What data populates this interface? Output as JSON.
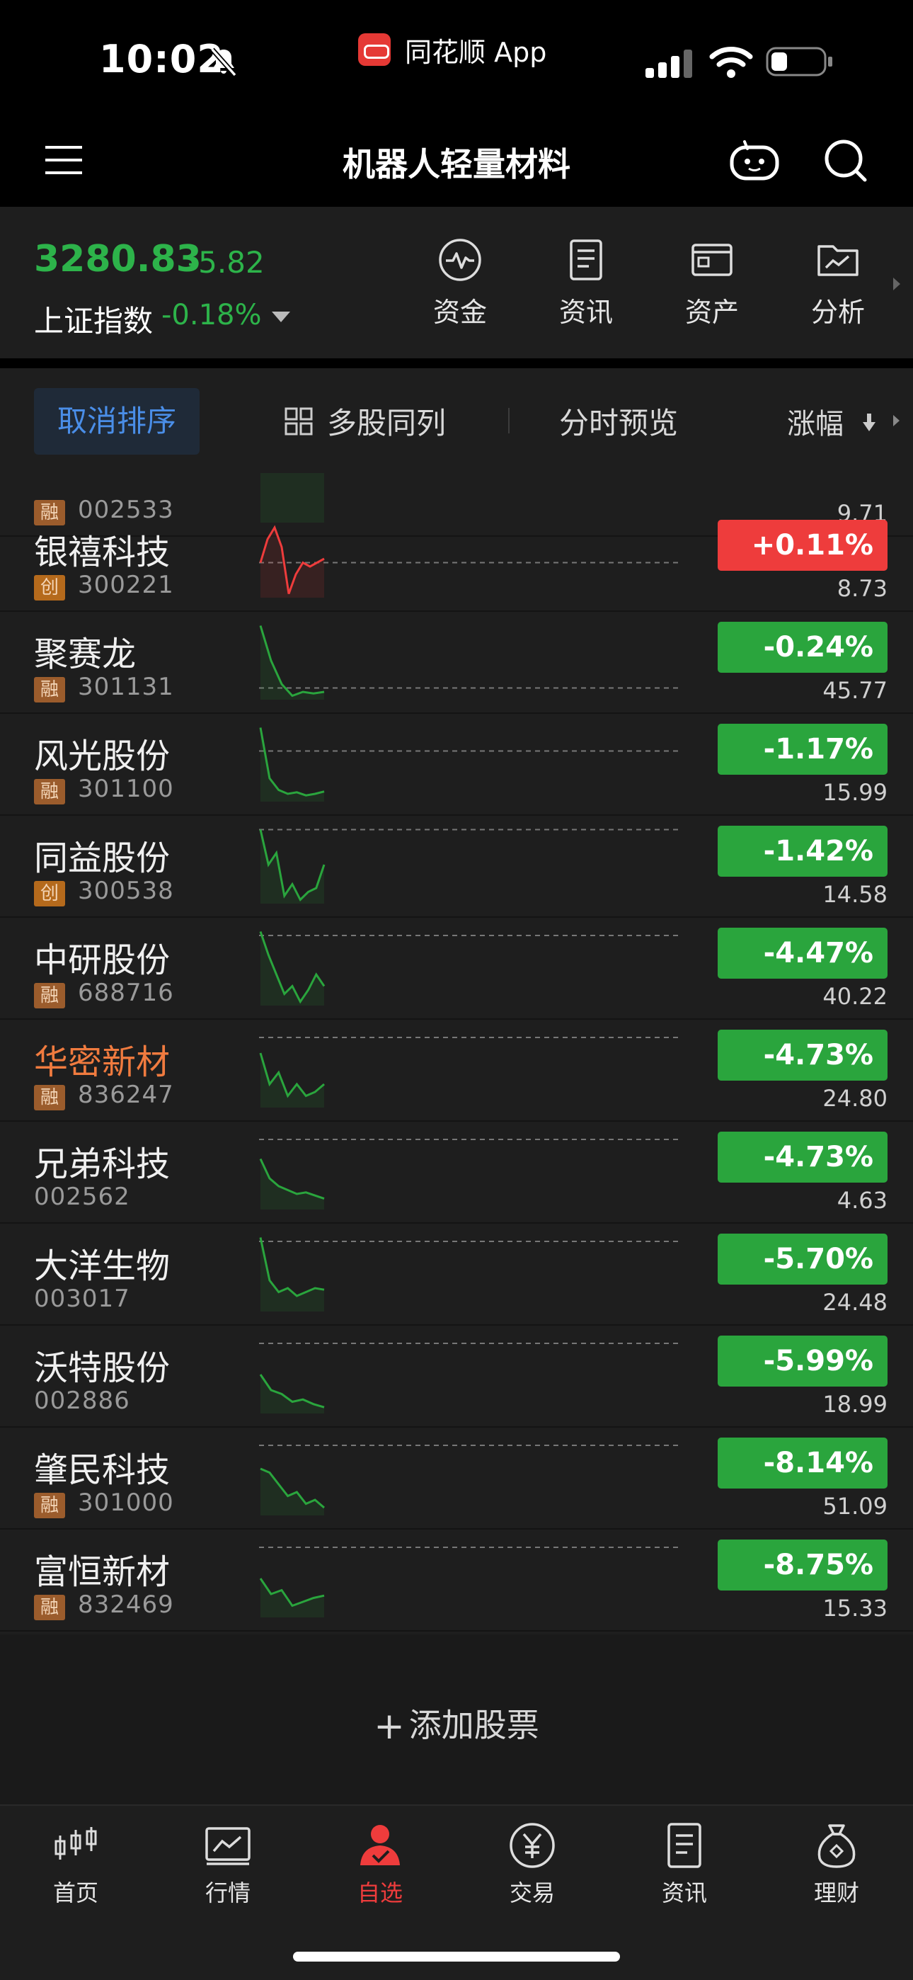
{
  "status_bar": {
    "time": "10:02",
    "app_name": "同花顺 App"
  },
  "nav": {
    "title": "机器人轻量材料"
  },
  "index": {
    "value": "3280.83",
    "change": "-5.82",
    "name": "上证指数",
    "pct": "-0.18%"
  },
  "tools": [
    {
      "label": "资金",
      "icon": "pulse-icon"
    },
    {
      "label": "资讯",
      "icon": "document-icon"
    },
    {
      "label": "资产",
      "icon": "wallet-icon"
    },
    {
      "label": "分析",
      "icon": "chart-folder-icon"
    }
  ],
  "sort_bar": {
    "cancel_sort": "取消排序",
    "multi_column": "多股同列",
    "preview": "分时预览",
    "sort_by": "涨幅"
  },
  "stocks": [
    {
      "name": "",
      "tag": "融",
      "code": "002533",
      "pct": "",
      "price": "9.71"
    },
    {
      "name": "银禧科技",
      "tag": "创",
      "code": "300221",
      "pct": "+0.11%",
      "price": "8.73"
    },
    {
      "name": "聚赛龙",
      "tag": "融",
      "code": "301131",
      "pct": "-0.24%",
      "price": "45.77"
    },
    {
      "name": "风光股份",
      "tag": "融",
      "code": "301100",
      "pct": "-1.17%",
      "price": "15.99"
    },
    {
      "name": "同益股份",
      "tag": "创",
      "code": "300538",
      "pct": "-1.42%",
      "price": "14.58"
    },
    {
      "name": "中研股份",
      "tag": "融",
      "code": "688716",
      "pct": "-4.47%",
      "price": "40.22"
    },
    {
      "name": "华密新材",
      "tag": "融",
      "code": "836247",
      "pct": "-4.73%",
      "price": "24.80"
    },
    {
      "name": "兄弟科技",
      "tag": "",
      "code": "002562",
      "pct": "-4.73%",
      "price": "4.63"
    },
    {
      "name": "大洋生物",
      "tag": "",
      "code": "003017",
      "pct": "-5.70%",
      "price": "24.48"
    },
    {
      "name": "沃特股份",
      "tag": "",
      "code": "002886",
      "pct": "-5.99%",
      "price": "18.99"
    },
    {
      "name": "肇民科技",
      "tag": "融",
      "code": "301000",
      "pct": "-8.14%",
      "price": "51.09"
    },
    {
      "name": "富恒新材",
      "tag": "融",
      "code": "832469",
      "pct": "-8.75%",
      "price": "15.33"
    }
  ],
  "add_stock": "添加股票",
  "tabs": [
    {
      "label": "首页",
      "icon": "candlestick-icon"
    },
    {
      "label": "行情",
      "icon": "trend-chart-icon"
    },
    {
      "label": "自选",
      "icon": "user-check-icon"
    },
    {
      "label": "交易",
      "icon": "yen-icon"
    },
    {
      "label": "资讯",
      "icon": "news-icon"
    },
    {
      "label": "理财",
      "icon": "money-bag-icon"
    }
  ],
  "colors": {
    "up": "#ee3c3c",
    "down": "#2aa53d",
    "accent_blue": "#4a8ee8",
    "highlight_name": "#f07b3f"
  }
}
